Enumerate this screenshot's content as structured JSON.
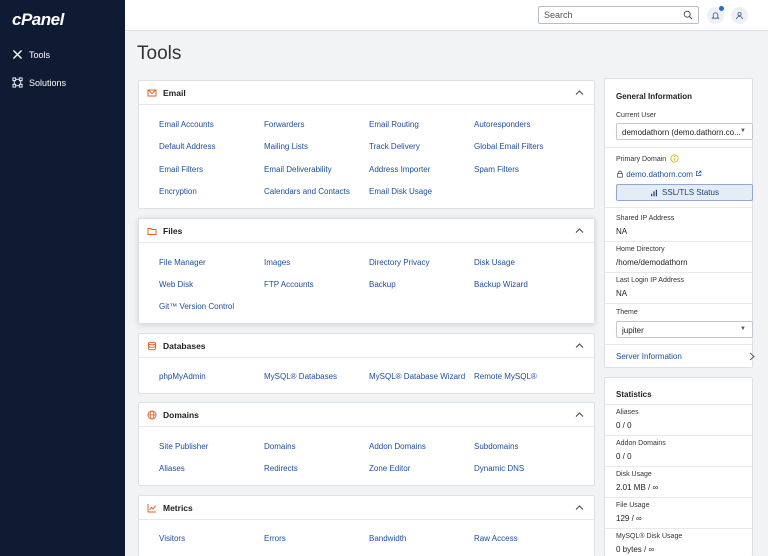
{
  "sidebar": {
    "logo": "cPanel",
    "items": [
      {
        "label": "Tools"
      },
      {
        "label": "Solutions"
      }
    ]
  },
  "search": {
    "placeholder": "Search"
  },
  "page_title": "Tools",
  "sections": {
    "email": {
      "title": "Email",
      "links": [
        "Email Accounts",
        "Forwarders",
        "Email Routing",
        "Autoresponders",
        "Default Address",
        "Mailing Lists",
        "Track Delivery",
        "Global Email Filters",
        "Email Filters",
        "Email Deliverability",
        "Address Importer",
        "Spam Filters",
        "Encryption",
        "Calendars and Contacts",
        "Email Disk Usage"
      ]
    },
    "files": {
      "title": "Files",
      "links": [
        "File Manager",
        "Images",
        "Directory Privacy",
        "Disk Usage",
        "Web Disk",
        "FTP Accounts",
        "Backup",
        "Backup Wizard",
        "Git™ Version Control"
      ]
    },
    "databases": {
      "title": "Databases",
      "links": [
        "phpMyAdmin",
        "MySQL® Databases",
        "MySQL® Database Wizard",
        "Remote MySQL®"
      ]
    },
    "domains": {
      "title": "Domains",
      "links": [
        "Site Publisher",
        "Domains",
        "Addon Domains",
        "Subdomains",
        "Aliases",
        "Redirects",
        "Zone Editor",
        "Dynamic DNS"
      ]
    },
    "metrics": {
      "title": "Metrics",
      "links": [
        "Visitors",
        "Errors",
        "Bandwidth",
        "Raw Access"
      ]
    }
  },
  "general": {
    "title": "General Information",
    "current_user_label": "Current User",
    "current_user_value": "demodathorn (demo.dathorn.co...",
    "primary_domain_label": "Primary Domain",
    "primary_domain_value": "demo.dathorn.com",
    "ssl_button": "SSL/TLS Status",
    "shared_ip_label": "Shared IP Address",
    "shared_ip_value": "NA",
    "home_dir_label": "Home Directory",
    "home_dir_value": "/home/demodathorn",
    "last_login_label": "Last Login IP Address",
    "last_login_value": "NA",
    "theme_label": "Theme",
    "theme_value": "jupiter",
    "server_info_link": "Server Information"
  },
  "statistics": {
    "title": "Statistics",
    "items": [
      {
        "label": "Aliases",
        "value": "0 / 0"
      },
      {
        "label": "Addon Domains",
        "value": "0 / 0"
      },
      {
        "label": "Disk Usage",
        "value": "2.01 MB / ∞"
      },
      {
        "label": "File Usage",
        "value": "129 / ∞"
      },
      {
        "label": "MySQL® Disk Usage",
        "value": "0 bytes / ∞"
      }
    ]
  },
  "colors": {
    "sidebar": "#0f1b33",
    "link": "#1d4fa0",
    "accent_orange": "#e0622b"
  }
}
